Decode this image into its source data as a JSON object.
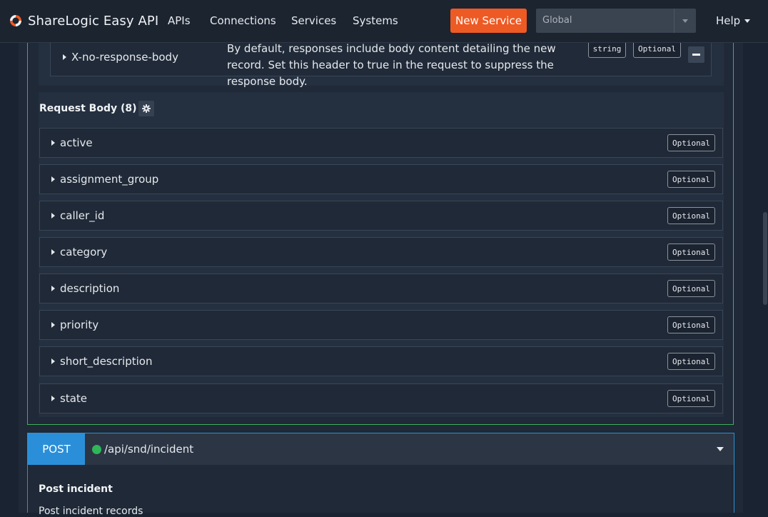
{
  "navbar": {
    "brand": "ShareLogic Easy API",
    "links": [
      "APIs",
      "Connections",
      "Services",
      "Systems"
    ],
    "new_service": "New Service",
    "scope_select": "Global",
    "help": "Help"
  },
  "header_param": {
    "name": "X-no-response-body",
    "description": "By default, responses include body content detailing the new record. Set this header to true in the request to suppress the response body.",
    "type": "string",
    "required": "Optional"
  },
  "request_body": {
    "title": "Request Body (8)",
    "fields": [
      {
        "name": "active",
        "required": "Optional"
      },
      {
        "name": "assignment_group",
        "required": "Optional"
      },
      {
        "name": "caller_id",
        "required": "Optional"
      },
      {
        "name": "category",
        "required": "Optional"
      },
      {
        "name": "description",
        "required": "Optional"
      },
      {
        "name": "priority",
        "required": "Optional"
      },
      {
        "name": "short_description",
        "required": "Optional"
      },
      {
        "name": "state",
        "required": "Optional"
      }
    ]
  },
  "post_op": {
    "method": "POST",
    "path": "/api/snd/incident",
    "title": "Post incident",
    "subtitle": "Post incident records"
  },
  "colors": {
    "accent_orange": "#ee5a24",
    "post_blue": "#2a8fd8",
    "status_green": "#2fb659",
    "expanded_border": "#3fae5c"
  }
}
